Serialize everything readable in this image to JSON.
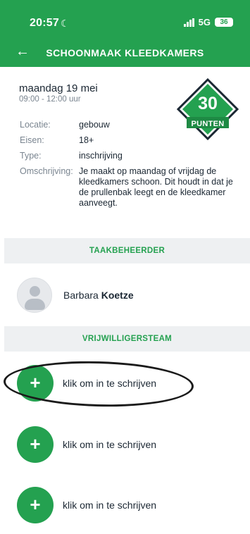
{
  "status_bar": {
    "time": "20:57",
    "network": "5G",
    "battery": "36",
    "icons": [
      "moon-icon",
      "signal-icon",
      "battery-icon"
    ]
  },
  "app_bar": {
    "title": "SCHOONMAAK KLEEDKAMERS",
    "back_icon": "arrow-left"
  },
  "event": {
    "date": "maandag 19 mei",
    "time": "09:00 - 12:00 uur",
    "points": {
      "value": "30",
      "label": "PUNTEN"
    },
    "details": [
      {
        "key": "Locatie:",
        "value": "gebouw"
      },
      {
        "key": "Eisen:",
        "value": "18+"
      },
      {
        "key": "Type:",
        "value": "inschrijving"
      },
      {
        "key": "Omschrijving:",
        "value": "Je maakt op maandag of vrijdag de kleedkamers schoon. Dit houdt in dat je de prullenbak leegt en de kleedkamer aanveegt."
      }
    ]
  },
  "manager": {
    "header": "TAAKBEHEERDER",
    "first_name": "Barbara",
    "last_name": "Koetze"
  },
  "volunteers": {
    "header": "VRIJWILLIGERSTEAM",
    "slots": [
      {
        "label": "klik om in te schrijven"
      },
      {
        "label": "klik om in te schrijven"
      },
      {
        "label": "klik om in te schrijven"
      }
    ]
  },
  "colors": {
    "brand_green": "#24a150",
    "section_bg": "#eef0f2",
    "text_dark": "#1b2733",
    "text_muted": "#7a8590"
  }
}
